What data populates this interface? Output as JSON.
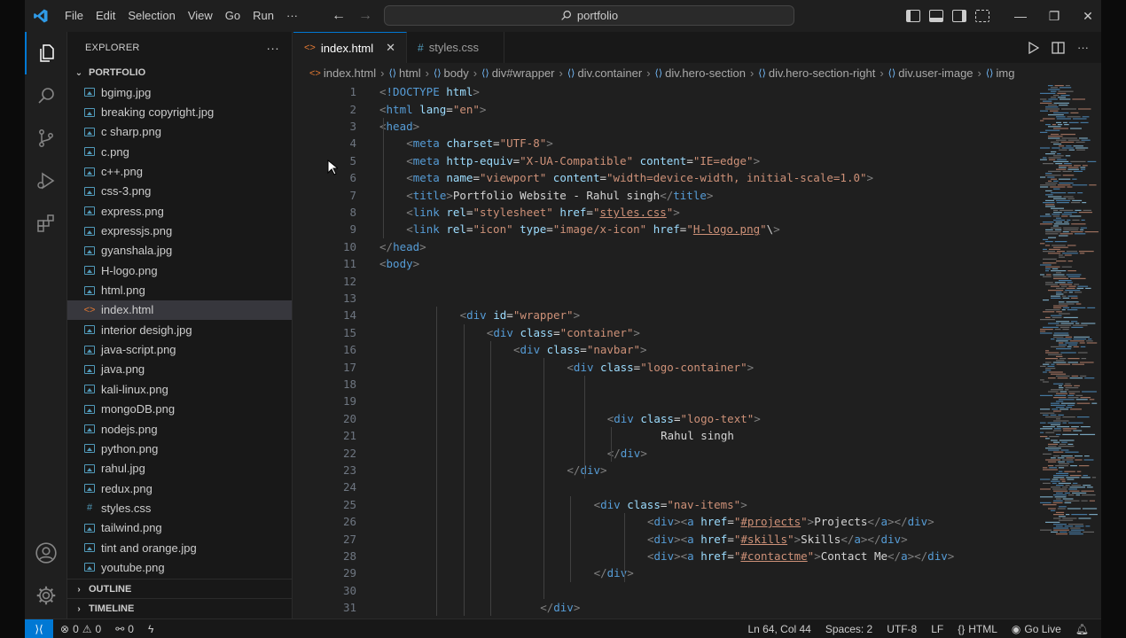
{
  "menu": [
    "File",
    "Edit",
    "Selection",
    "View",
    "Go",
    "Run",
    "···"
  ],
  "search": {
    "text": "portfolio"
  },
  "window_controls": {
    "minimize": "—",
    "restore": "❐",
    "close": "✕"
  },
  "explorer": {
    "title": "EXPLORER",
    "more": "···",
    "folder": "PORTFOLIO",
    "files": [
      {
        "name": "bgimg.jpg",
        "kind": "image"
      },
      {
        "name": "breaking copyright.jpg",
        "kind": "image"
      },
      {
        "name": "c sharp.png",
        "kind": "image"
      },
      {
        "name": "c.png",
        "kind": "image"
      },
      {
        "name": "c++.png",
        "kind": "image"
      },
      {
        "name": "css-3.png",
        "kind": "image"
      },
      {
        "name": "express.png",
        "kind": "image"
      },
      {
        "name": "expressjs.png",
        "kind": "image"
      },
      {
        "name": "gyanshala.jpg",
        "kind": "image"
      },
      {
        "name": "H-logo.png",
        "kind": "image"
      },
      {
        "name": "html.png",
        "kind": "image"
      },
      {
        "name": "index.html",
        "kind": "html"
      },
      {
        "name": "interior desigh.jpg",
        "kind": "image"
      },
      {
        "name": "java-script.png",
        "kind": "image"
      },
      {
        "name": "java.png",
        "kind": "image"
      },
      {
        "name": "kali-linux.png",
        "kind": "image"
      },
      {
        "name": "mongoDB.png",
        "kind": "image"
      },
      {
        "name": "nodejs.png",
        "kind": "image"
      },
      {
        "name": "python.png",
        "kind": "image"
      },
      {
        "name": "rahul.jpg",
        "kind": "image"
      },
      {
        "name": "redux.png",
        "kind": "image"
      },
      {
        "name": "styles.css",
        "kind": "css"
      },
      {
        "name": "tailwind.png",
        "kind": "image"
      },
      {
        "name": "tint and orange.jpg",
        "kind": "image"
      },
      {
        "name": "youtube.png",
        "kind": "image"
      }
    ],
    "active_file": "index.html",
    "outline": "OUTLINE",
    "timeline": "TIMELINE"
  },
  "tabs": [
    {
      "label": "index.html",
      "icon": "<>",
      "active": true
    },
    {
      "label": "styles.css",
      "icon": "#",
      "active": false
    }
  ],
  "breadcrumb": [
    "index.html",
    "html",
    "body",
    "div#wrapper",
    "div.container",
    "div.hero-section",
    "div.hero-section-right",
    "div.user-image",
    "img"
  ],
  "code_lines": [
    {
      "n": "1",
      "indent": 0,
      "html": "<span class='p'>&lt;</span><span class='t'>!DOCTYPE</span> <span class='a'>html</span><span class='p'>&gt;</span>"
    },
    {
      "n": "2",
      "indent": 0,
      "html": "<span class='p'>&lt;</span><span class='t'>html</span> <span class='a'>lang</span><span class='x'>=</span><span class='v'>\"en\"</span><span class='p'>&gt;</span>"
    },
    {
      "n": "3",
      "indent": 0,
      "html": "<span class='p'>&lt;</span><span class='t'>head</span><span class='p'>&gt;</span>"
    },
    {
      "n": "4",
      "indent": 1,
      "html": "<span class='p'>&lt;</span><span class='t'>meta</span> <span class='a'>charset</span><span class='x'>=</span><span class='v'>\"UTF-8\"</span><span class='p'>&gt;</span>"
    },
    {
      "n": "5",
      "indent": 1,
      "html": "<span class='p'>&lt;</span><span class='t'>meta</span> <span class='a'>http-equiv</span><span class='x'>=</span><span class='v'>\"X-UA-Compatible\"</span> <span class='a'>content</span><span class='x'>=</span><span class='v'>\"IE=edge\"</span><span class='p'>&gt;</span>"
    },
    {
      "n": "6",
      "indent": 1,
      "html": "<span class='p'>&lt;</span><span class='t'>meta</span> <span class='a'>name</span><span class='x'>=</span><span class='v'>\"viewport\"</span> <span class='a'>content</span><span class='x'>=</span><span class='v'>\"width=device-width, initial-scale=1.0\"</span><span class='p'>&gt;</span>"
    },
    {
      "n": "7",
      "indent": 1,
      "html": "<span class='p'>&lt;</span><span class='t'>title</span><span class='p'>&gt;</span><span class='x'>Portfolio Website - Rahul singh</span><span class='p'>&lt;/</span><span class='t'>title</span><span class='p'>&gt;</span>"
    },
    {
      "n": "8",
      "indent": 1,
      "html": "<span class='p'>&lt;</span><span class='t'>link</span> <span class='a'>rel</span><span class='x'>=</span><span class='v'>\"stylesheet\"</span> <span class='a'>href</span><span class='x'>=</span><span class='v'>\"<u>styles.css</u>\"</span><span class='p'>&gt;</span>"
    },
    {
      "n": "9",
      "indent": 1,
      "html": "<span class='p'>&lt;</span><span class='t'>link</span> <span class='a'>rel</span><span class='x'>=</span><span class='v'>\"icon\"</span> <span class='a'>type</span><span class='x'>=</span><span class='v'>\"image/x-icon\"</span> <span class='a'>href</span><span class='x'>=</span><span class='v'>\"<u>H-logo.png</u>\"</span><span class='x'>\\</span><span class='p'>&gt;</span>"
    },
    {
      "n": "10",
      "indent": 0,
      "html": "<span class='p'>&lt;/</span><span class='t'>head</span><span class='p'>&gt;</span>"
    },
    {
      "n": "11",
      "indent": 0,
      "html": "<span class='p'>&lt;</span><span class='t'>body</span><span class='p'>&gt;</span>"
    },
    {
      "n": "12",
      "indent": 0,
      "html": ""
    },
    {
      "n": "13",
      "indent": 0,
      "html": ""
    },
    {
      "n": "14",
      "indent": 3,
      "html": "<span class='p'>&lt;</span><span class='t'>div</span> <span class='a'>id</span><span class='x'>=</span><span class='v'>\"wrapper\"</span><span class='p'>&gt;</span>"
    },
    {
      "n": "15",
      "indent": 4,
      "html": "<span class='p'>&lt;</span><span class='t'>div</span> <span class='a'>class</span><span class='x'>=</span><span class='v'>\"container\"</span><span class='p'>&gt;</span>"
    },
    {
      "n": "16",
      "indent": 5,
      "html": "<span class='p'>&lt;</span><span class='t'>div</span> <span class='a'>class</span><span class='x'>=</span><span class='v'>\"navbar\"</span><span class='p'>&gt;</span>"
    },
    {
      "n": "17",
      "indent": 7,
      "html": "<span class='p'>&lt;</span><span class='t'>div</span> <span class='a'>class</span><span class='x'>=</span><span class='v'>\"logo-container\"</span><span class='p'>&gt;</span>"
    },
    {
      "n": "18",
      "indent": 0,
      "html": ""
    },
    {
      "n": "19",
      "indent": 0,
      "html": ""
    },
    {
      "n": "20",
      "indent": 8.5,
      "html": "<span class='p'>&lt;</span><span class='t'>div</span> <span class='a'>class</span><span class='x'>=</span><span class='v'>\"logo-text\"</span><span class='p'>&gt;</span>"
    },
    {
      "n": "21",
      "indent": 10.5,
      "html": "<span class='x'>Rahul singh</span>"
    },
    {
      "n": "22",
      "indent": 8.5,
      "html": "<span class='p'>&lt;/</span><span class='t'>div</span><span class='p'>&gt;</span>"
    },
    {
      "n": "23",
      "indent": 7,
      "html": "<span class='p'>&lt;/</span><span class='t'>div</span><span class='p'>&gt;</span>"
    },
    {
      "n": "24",
      "indent": 0,
      "html": ""
    },
    {
      "n": "25",
      "indent": 8,
      "html": "<span class='p'>&lt;</span><span class='t'>div</span> <span class='a'>class</span><span class='x'>=</span><span class='v'>\"nav-items\"</span><span class='p'>&gt;</span>"
    },
    {
      "n": "26",
      "indent": 10,
      "html": "<span class='p'>&lt;</span><span class='t'>div</span><span class='p'>&gt;&lt;</span><span class='t'>a</span> <span class='a'>href</span><span class='x'>=</span><span class='v'>\"<u>#projects</u>\"</span><span class='p'>&gt;</span><span class='x'>Projects</span><span class='p'>&lt;/</span><span class='t'>a</span><span class='p'>&gt;&lt;/</span><span class='t'>div</span><span class='p'>&gt;</span>"
    },
    {
      "n": "27",
      "indent": 10,
      "html": "<span class='p'>&lt;</span><span class='t'>div</span><span class='p'>&gt;&lt;</span><span class='t'>a</span> <span class='a'>href</span><span class='x'>=</span><span class='v'>\"<u>#skills</u>\"</span><span class='p'>&gt;</span><span class='x'>Skills</span><span class='p'>&lt;/</span><span class='t'>a</span><span class='p'>&gt;&lt;/</span><span class='t'>div</span><span class='p'>&gt;</span>"
    },
    {
      "n": "28",
      "indent": 10,
      "html": "<span class='p'>&lt;</span><span class='t'>div</span><span class='p'>&gt;&lt;</span><span class='t'>a</span> <span class='a'>href</span><span class='x'>=</span><span class='v'>\"<u>#contactme</u>\"</span><span class='p'>&gt;</span><span class='x'>Contact Me</span><span class='p'>&lt;/</span><span class='t'>a</span><span class='p'>&gt;&lt;/</span><span class='t'>div</span><span class='p'>&gt;</span>"
    },
    {
      "n": "29",
      "indent": 8,
      "html": "<span class='p'>&lt;/</span><span class='t'>div</span><span class='p'>&gt;</span>"
    },
    {
      "n": "30",
      "indent": 0,
      "html": ""
    },
    {
      "n": "31",
      "indent": 6,
      "html": "<span class='p'>&lt;/</span><span class='t'>div</span><span class='p'>&gt;</span>"
    }
  ],
  "status": {
    "errors": "0",
    "warnings": "0",
    "ports": "0",
    "position": "Ln 64, Col 44",
    "spaces": "Spaces: 2",
    "encoding": "UTF-8",
    "eol": "LF",
    "language": "HTML",
    "golive": "Go Live"
  },
  "colors": {
    "accent": "#0078d4",
    "tag": "#569cd6",
    "attr": "#9cdcfe",
    "string": "#ce9178",
    "bg": "#1f1f1f"
  }
}
